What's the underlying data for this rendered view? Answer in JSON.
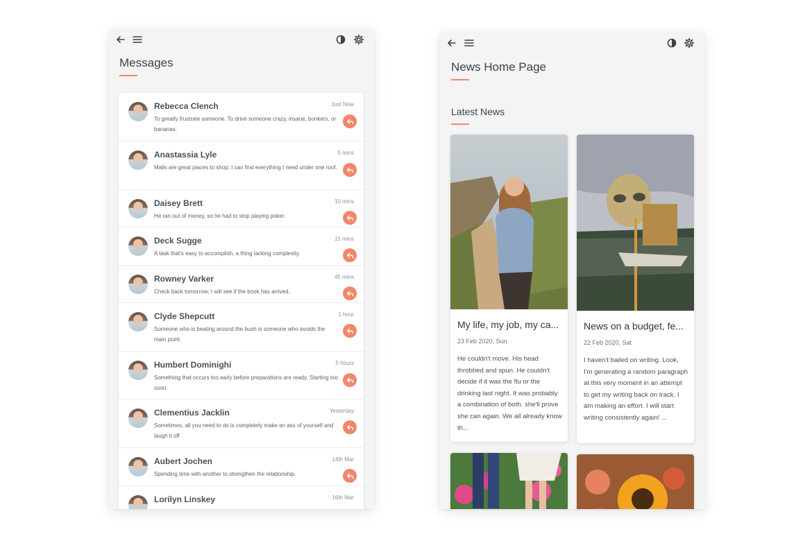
{
  "messages_screen": {
    "title": "Messages",
    "accent_color": "#f1876a",
    "icons": {
      "back": "arrow-left-icon",
      "menu": "hamburger-menu-icon",
      "theme": "contrast-icon",
      "settings": "gear-icon",
      "reply": "reply-icon"
    },
    "messages": [
      {
        "name": "Rebecca Clench",
        "time": "Just Now",
        "text": "To greatly frustrate someone. To drive someone crazy, insane, bonkers, or bananas."
      },
      {
        "name": "Anastassia Lyle",
        "time": "5 mins",
        "text": "Malls are great places to shop; I can find everything I need under one roof."
      },
      {
        "name": "Daisey Brett",
        "time": "10 mins",
        "text": "He ran out of money, so he had to stop playing poker."
      },
      {
        "name": "Deck Sugge",
        "time": "15 mins",
        "text": "A task that's easy to accomplish, a thing lacking complexity."
      },
      {
        "name": "Rowney Varker",
        "time": "45 mins",
        "text": "Check back tomorrow; I will see if the book has arrived."
      },
      {
        "name": "Clyde Shepcutt",
        "time": "1 hour",
        "text": "Someone who is beating around the bush is someone who avoids the main point."
      },
      {
        "name": "Humbert Dominighi",
        "time": "5 hours",
        "text": "Something that occurs too early before preparations are ready. Starting too soon."
      },
      {
        "name": "Clementius Jacklin",
        "time": "Yesterday",
        "text": "Sometimes, all you need to do is completely make an ass of yourself and laugh it off"
      },
      {
        "name": "Aubert Jochen",
        "time": "14th Mar",
        "text": "Spending time with another to strengthen the relationship."
      },
      {
        "name": "Lorilyn Linskey",
        "time": "16th Mar",
        "text": ""
      }
    ]
  },
  "news_screen": {
    "title": "News Home Page",
    "section_title": "Latest News",
    "articles": [
      {
        "title": "My life, my job, my ca...",
        "date": "23 Feb 2020, Sun",
        "body": "He couldn't move. His head throbbed and spun. He couldn't decide if it was the flu or the drinking last night. It was probably a combination of both. she'll prove she can again. We all already know th..."
      },
      {
        "title": "News on a budget, fe...",
        "date": "22 Feb 2020, Sat",
        "body": "I haven't bailed on writing. Look, I'm generating a random paragraph at this very moment in an attempt to get my writing back on track. I am making an effort. I will start writing consistently again! ..."
      }
    ]
  }
}
